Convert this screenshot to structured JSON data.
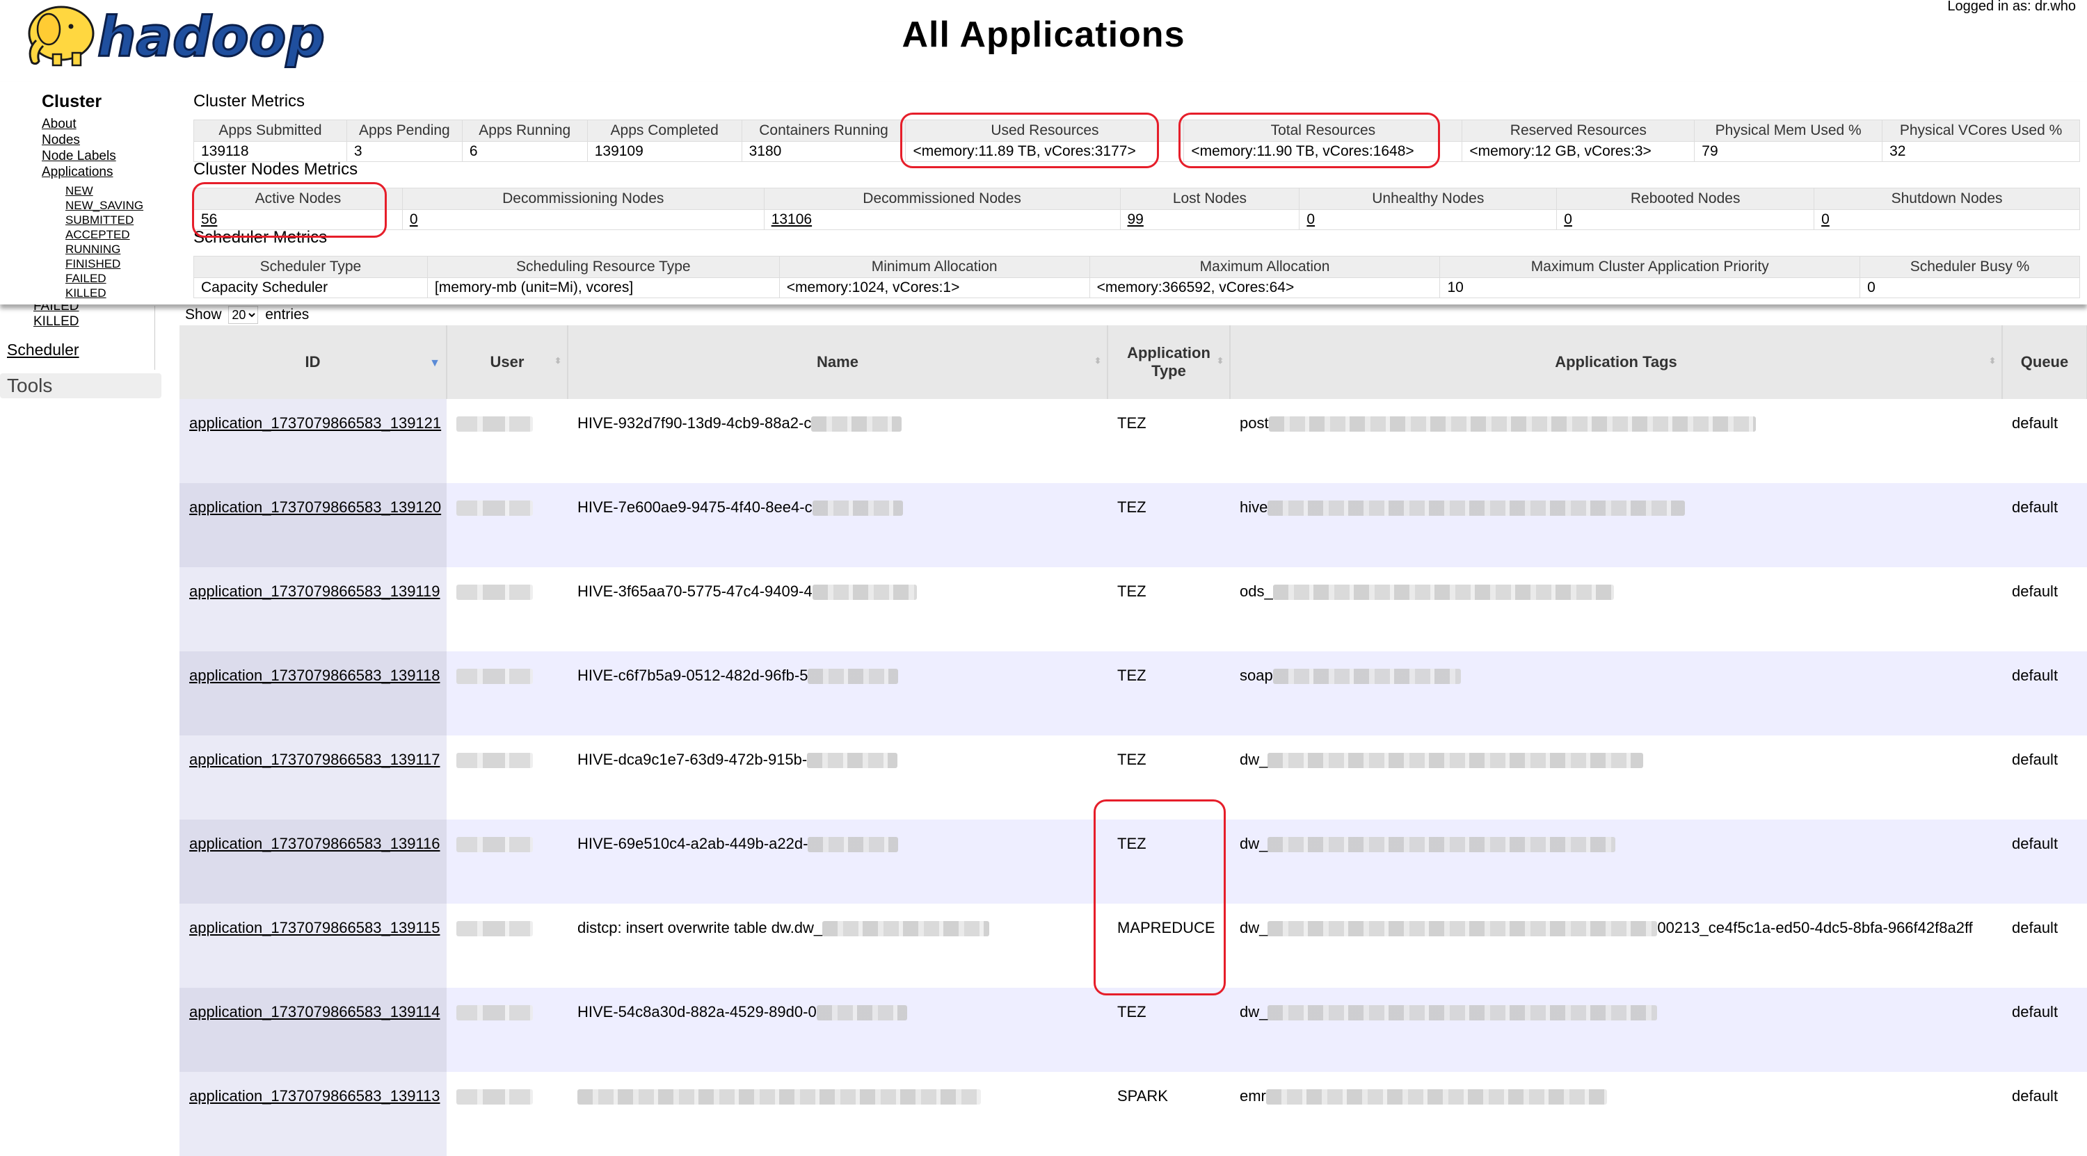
{
  "header": {
    "title": "All Applications",
    "logged_in": "Logged in as: dr.who",
    "logo_text": "hadoop"
  },
  "nav": {
    "cluster_heading": "Cluster",
    "links": [
      "About",
      "Nodes",
      "Node Labels",
      "Applications"
    ],
    "app_states": [
      "NEW",
      "NEW_SAVING",
      "SUBMITTED",
      "ACCEPTED",
      "RUNNING",
      "FINISHED",
      "FAILED",
      "KILLED"
    ],
    "peek_failed": "FAILED",
    "peek_killed": "KILLED",
    "scheduler": "Scheduler",
    "tools": "Tools"
  },
  "cluster_metrics": {
    "title": "Cluster Metrics",
    "headers": [
      "Apps Submitted",
      "Apps Pending",
      "Apps Running",
      "Apps Completed",
      "Containers Running",
      "Used Resources",
      "Total Resources",
      "Reserved Resources",
      "Physical Mem Used %",
      "Physical VCores Used %"
    ],
    "values": [
      "139118",
      "3",
      "6",
      "139109",
      "3180",
      "<memory:11.89 TB, vCores:3177>",
      "<memory:11.90 TB, vCores:1648>",
      "<memory:12 GB, vCores:3>",
      "79",
      "32"
    ]
  },
  "node_metrics": {
    "title": "Cluster Nodes Metrics",
    "headers": [
      "Active Nodes",
      "Decommissioning Nodes",
      "Decommissioned Nodes",
      "Lost Nodes",
      "Unhealthy Nodes",
      "Rebooted Nodes",
      "Shutdown Nodes"
    ],
    "values": [
      "56",
      "0",
      "13106",
      "99",
      "0",
      "0",
      "0"
    ]
  },
  "scheduler_metrics": {
    "title": "Scheduler Metrics",
    "headers": [
      "Scheduler Type",
      "Scheduling Resource Type",
      "Minimum Allocation",
      "Maximum Allocation",
      "Maximum Cluster Application Priority",
      "Scheduler Busy %"
    ],
    "values": [
      "Capacity Scheduler",
      "[memory-mb (unit=Mi), vcores]",
      "<memory:1024, vCores:1>",
      "<memory:366592, vCores:64>",
      "10",
      "0"
    ]
  },
  "entries": {
    "show": "Show",
    "page_size": "20",
    "suffix": "entries"
  },
  "apps_table": {
    "columns": [
      "ID",
      "User",
      "Name",
      "Application Type",
      "Application Tags",
      "Queue"
    ],
    "rows": [
      {
        "id": "application_1737079866583_139121",
        "name": "HIVE-932d7f90-13d9-4cb9-88a2-c",
        "type": "TEZ",
        "tags": "post",
        "tags_suffix": "",
        "queue": "default"
      },
      {
        "id": "application_1737079866583_139120",
        "name": "HIVE-7e600ae9-9475-4f40-8ee4-c",
        "type": "TEZ",
        "tags": "hive",
        "tags_suffix": "",
        "queue": "default"
      },
      {
        "id": "application_1737079866583_139119",
        "name": "HIVE-3f65aa70-5775-47c4-9409-4",
        "type": "TEZ",
        "tags": "ods_",
        "tags_suffix": "",
        "queue": "default"
      },
      {
        "id": "application_1737079866583_139118",
        "name": "HIVE-c6f7b5a9-0512-482d-96fb-5",
        "type": "TEZ",
        "tags": "soap",
        "tags_suffix": "",
        "queue": "default"
      },
      {
        "id": "application_1737079866583_139117",
        "name": "HIVE-dca9c1e7-63d9-472b-915b-",
        "type": "TEZ",
        "tags": "dw_",
        "tags_suffix": "",
        "queue": "default"
      },
      {
        "id": "application_1737079866583_139116",
        "name": "HIVE-69e510c4-a2ab-449b-a22d-",
        "type": "TEZ",
        "tags": "dw_",
        "tags_suffix": "",
        "queue": "default"
      },
      {
        "id": "application_1737079866583_139115",
        "name": "distcp: insert overwrite table dw.dw_",
        "type": "MAPREDUCE",
        "tags": "dw_",
        "tags_suffix": "00213_ce4f5c1a-ed50-4dc5-8bfa-966f42f8a2ff",
        "queue": "default"
      },
      {
        "id": "application_1737079866583_139114",
        "name": "HIVE-54c8a30d-882a-4529-89d0-0",
        "type": "TEZ",
        "tags": "dw_",
        "tags_suffix": "",
        "queue": "default"
      },
      {
        "id": "application_1737079866583_139113",
        "name": "",
        "type": "SPARK",
        "tags": "emr",
        "tags_suffix": "",
        "queue": "default"
      }
    ]
  },
  "colors": {
    "highlight": "#e61e2a",
    "row_alt": "#eeeeff",
    "header_bg": "#eeeeee"
  }
}
